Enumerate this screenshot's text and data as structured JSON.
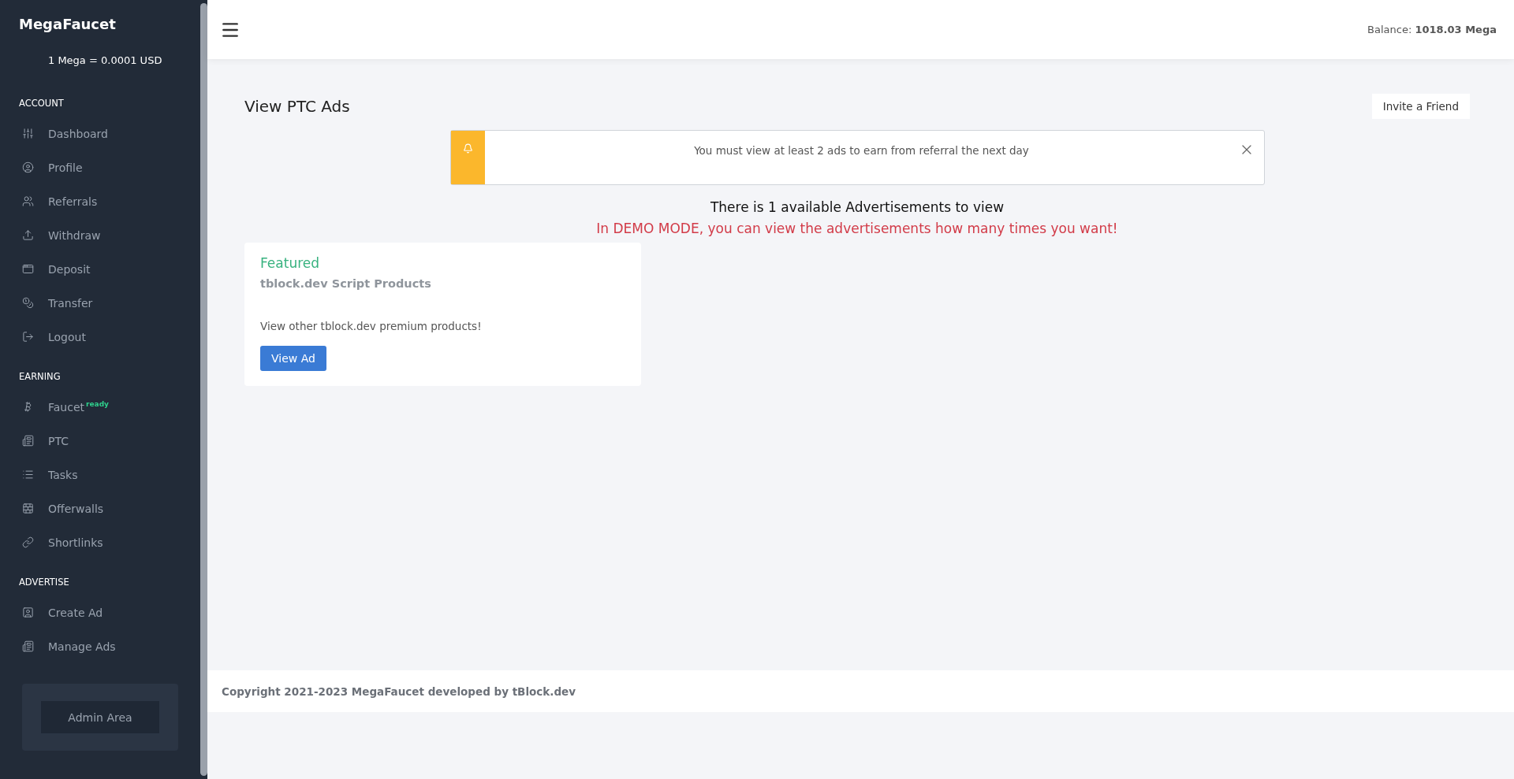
{
  "sidebar": {
    "brand": "MegaFaucet",
    "rate": "1 Mega = 0.0001 USD",
    "sections": [
      {
        "title": "ACCOUNT",
        "items": [
          {
            "label": "Dashboard"
          },
          {
            "label": "Profile"
          },
          {
            "label": "Referrals"
          },
          {
            "label": "Withdraw"
          },
          {
            "label": "Deposit"
          },
          {
            "label": "Transfer"
          },
          {
            "label": "Logout"
          }
        ]
      },
      {
        "title": "EARNING",
        "items": [
          {
            "label": "Faucet",
            "badge": "ready"
          },
          {
            "label": "PTC"
          },
          {
            "label": "Tasks"
          },
          {
            "label": "Offerwalls"
          },
          {
            "label": "Shortlinks"
          }
        ]
      },
      {
        "title": "ADVERTISE",
        "items": [
          {
            "label": "Create Ad"
          },
          {
            "label": "Manage Ads"
          }
        ]
      }
    ],
    "admin_button": "Admin Area"
  },
  "header": {
    "balance_label": "Balance:",
    "balance_value": "1018.03 Mega"
  },
  "page": {
    "title": "View PTC Ads",
    "invite_button": "Invite a Friend",
    "alert": {
      "text": "You must view at least 2 ads to earn from referral the next day"
    },
    "available_text": "There is 1 available Advertisements to view",
    "demo_text": "In DEMO MODE, you can view the advertisements how many times you want!",
    "ads": [
      {
        "tag": "Featured",
        "title": "tblock.dev Script Products",
        "description": "View other tblock.dev premium products!",
        "button": "View Ad"
      }
    ]
  },
  "footer": {
    "text": "Copyright 2021-2023 MegaFaucet developed by tBlock.dev"
  }
}
